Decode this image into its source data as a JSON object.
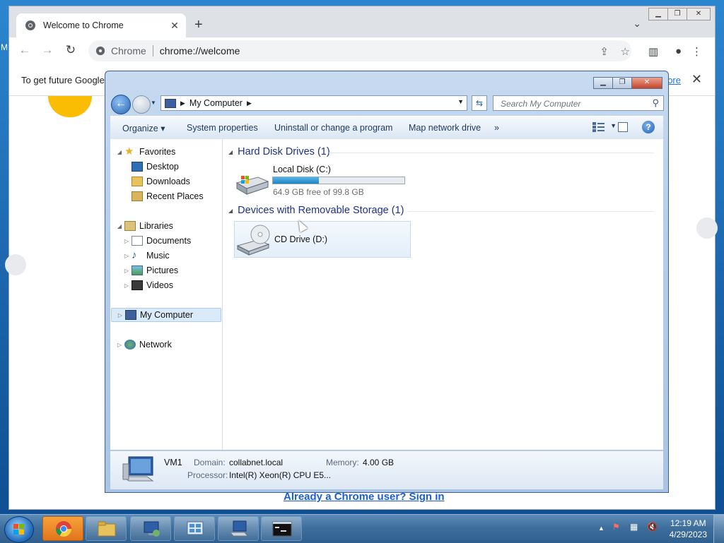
{
  "chrome": {
    "tab_title": "Welcome to Chrome",
    "tab_close": "✕",
    "new_tab": "+",
    "tab_dropdown": "⌄",
    "site_label": "Chrome",
    "url": "chrome://welcome",
    "infobar_text": "To get future Google",
    "infobar_link_tail": "ore",
    "infobar_close": "✕",
    "signin_text": "Already a Chrome user? Sign in"
  },
  "explorer": {
    "address_path": "My Computer",
    "search_placeholder": "Search My Computer",
    "commands": {
      "organize": "Organize ▾",
      "system_properties": "System properties",
      "uninstall": "Uninstall or change a program",
      "map_drive": "Map network drive",
      "more": "»"
    },
    "nav": {
      "favorites": "Favorites",
      "desktop": "Desktop",
      "downloads": "Downloads",
      "recent": "Recent Places",
      "libraries": "Libraries",
      "documents": "Documents",
      "music": "Music",
      "pictures": "Pictures",
      "videos": "Videos",
      "computer": "My Computer",
      "network": "Network"
    },
    "groups": {
      "hdd": "Hard Disk Drives (1)",
      "removable": "Devices with Removable Storage (1)"
    },
    "local_disk": {
      "name": "Local Disk (C:)",
      "free": "64.9 GB free of 99.8 GB",
      "used_fraction": 0.35
    },
    "cd_drive": {
      "name": "CD Drive (D:)"
    },
    "details": {
      "name": "VM1",
      "domain_label": "Domain:",
      "domain_value": "collabnet.local",
      "memory_label": "Memory:",
      "memory_value": "4.00 GB",
      "processor_label": "Processor:",
      "processor_value": "Intel(R) Xeon(R) CPU E5..."
    }
  },
  "taskbar": {
    "time": "12:19 AM",
    "date": "4/29/2023",
    "tray_arrow": "▲"
  },
  "colors": {
    "explorer_frame": "#b4cde9",
    "chrome_link": "#1a73e8",
    "taskbar": "#3e6e9c"
  }
}
